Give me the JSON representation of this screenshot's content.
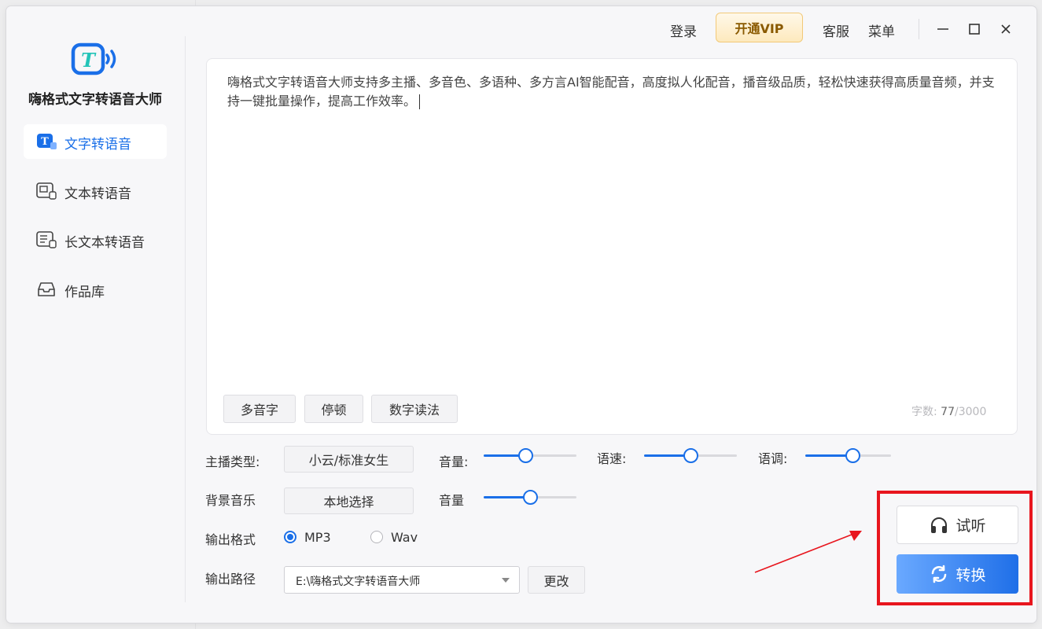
{
  "app": {
    "title": "嗨格式文字转语音大师"
  },
  "topbar": {
    "login": "登录",
    "vip": "开通VIP",
    "service": "客服",
    "menu": "菜单"
  },
  "sidebar": {
    "items": [
      {
        "label": "文字转语音",
        "icon": "text-speech-icon",
        "active": true
      },
      {
        "label": "文本转语音",
        "icon": "doc-speech-icon"
      },
      {
        "label": "长文本转语音",
        "icon": "longdoc-speech-icon"
      },
      {
        "label": "作品库",
        "icon": "inbox-icon"
      }
    ]
  },
  "editor": {
    "text": "嗨格式文字转语音大师支持多主播、多音色、多语种、多方言AI智能配音，高度拟人化配音，播音级品质，轻松快速获得高质量音频，并支持一键批量操作，提高工作效率。",
    "tools": {
      "polyphone": "多音字",
      "pause": "停顿",
      "number_reading": "数字读法"
    },
    "word_count": {
      "label": "字数:",
      "current": "77",
      "max": "/3000"
    }
  },
  "settings": {
    "anchor": {
      "label": "主播类型:",
      "value": "小云/标准女生"
    },
    "volume": {
      "label": "音量:",
      "value": 0.45
    },
    "speed": {
      "label": "语速:",
      "value": 0.5
    },
    "pitch": {
      "label": "语调:",
      "value": 0.55
    },
    "bgm": {
      "label": "背景音乐",
      "button": "本地选择",
      "volume_label": "音量",
      "volume": 0.5
    },
    "format": {
      "label": "输出格式",
      "options": [
        "MP3",
        "Wav"
      ],
      "selected": "MP3"
    },
    "path": {
      "label": "输出路径",
      "value": "E:\\嗨格式文字转语音大师",
      "change": "更改"
    }
  },
  "actions": {
    "listen": "试听",
    "convert": "转换"
  },
  "colors": {
    "accent": "#1a6fe8",
    "highlight": "#e8161e",
    "vip_text": "#8a5a00"
  }
}
